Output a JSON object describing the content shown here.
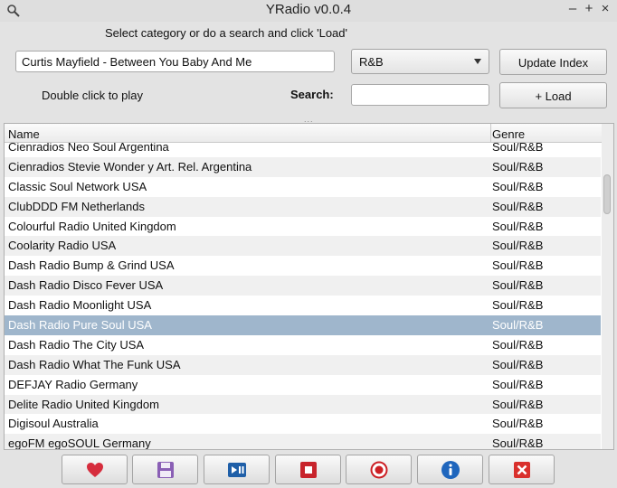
{
  "window": {
    "title": "YRadio v0.0.4",
    "controls": {
      "minimize": "–",
      "maximize": "+",
      "close": "×"
    }
  },
  "instructions": "Select category or do a search and click 'Load'",
  "now_playing": "Curtis Mayfield - Between You Baby And Me",
  "category": {
    "selected": "R&B"
  },
  "update_button": "Update Index",
  "play_hint": "Double click to play",
  "search": {
    "label": "Search:",
    "value": ""
  },
  "load_button": "+ Load",
  "splitter_grip": "...",
  "table": {
    "columns": [
      "Name",
      "Genre"
    ],
    "rows": [
      {
        "name": "Cienradios Neo Soul Argentina",
        "genre": "Soul/R&B"
      },
      {
        "name": "Cienradios Stevie Wonder y Art. Rel. Argentina",
        "genre": "Soul/R&B"
      },
      {
        "name": "Classic Soul Network USA",
        "genre": "Soul/R&B"
      },
      {
        "name": "ClubDDD FM Netherlands",
        "genre": "Soul/R&B"
      },
      {
        "name": "Colourful Radio United Kingdom",
        "genre": "Soul/R&B"
      },
      {
        "name": "Coolarity Radio USA",
        "genre": "Soul/R&B"
      },
      {
        "name": "Dash Radio Bump & Grind USA",
        "genre": "Soul/R&B"
      },
      {
        "name": "Dash Radio Disco Fever USA",
        "genre": "Soul/R&B"
      },
      {
        "name": "Dash Radio Moonlight USA",
        "genre": "Soul/R&B"
      },
      {
        "name": "Dash Radio Pure Soul USA",
        "genre": "Soul/R&B",
        "selected": true
      },
      {
        "name": "Dash Radio The City USA",
        "genre": "Soul/R&B"
      },
      {
        "name": "Dash Radio What The Funk USA",
        "genre": "Soul/R&B"
      },
      {
        "name": "DEFJAY Radio Germany",
        "genre": "Soul/R&B"
      },
      {
        "name": "Delite Radio United Kingdom",
        "genre": "Soul/R&B"
      },
      {
        "name": "Digisoul Australia",
        "genre": "Soul/R&B"
      },
      {
        "name": "egoFM egoSOUL Germany",
        "genre": "Soul/R&B"
      }
    ]
  },
  "toolbar": [
    {
      "icon": "heart-icon",
      "color": "#d62d3d"
    },
    {
      "icon": "save-icon",
      "color": "#8a5fb5"
    },
    {
      "icon": "play-pause-icon",
      "color": "#1f5fa8"
    },
    {
      "icon": "stop-icon",
      "color": "#c8242c"
    },
    {
      "icon": "record-icon",
      "color": "#cc1f24"
    },
    {
      "icon": "info-icon",
      "color": "#1f66bd"
    },
    {
      "icon": "exit-icon",
      "color": "#d9302c"
    }
  ]
}
